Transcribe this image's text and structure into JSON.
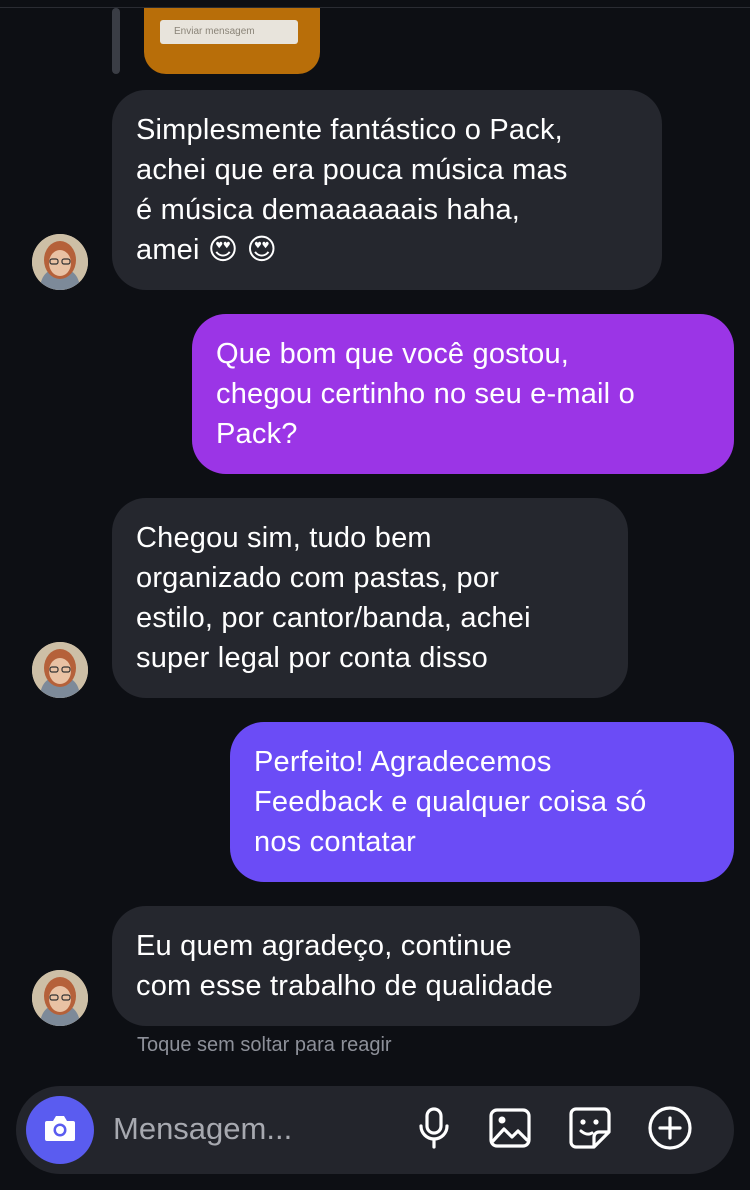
{
  "reply_preview": {
    "text": "Enviar mensagem"
  },
  "messages": [
    {
      "direction": "incoming",
      "text": "Simplesmente fantástico o Pack,\nachei que era pouca música mas\né música demaaaaaais haha,\namei 😍 😍"
    },
    {
      "direction": "outgoing",
      "text": "Que bom que você gostou,\nchegou certinho no seu e-mail o\nPack?"
    },
    {
      "direction": "incoming",
      "text": "Chegou sim, tudo bem\norganizado com pastas, por\nestilo, por cantor/banda, achei\nsuper legal por conta disso"
    },
    {
      "direction": "outgoing",
      "text": "Perfeito! Agradecemos\nFeedback e qualquer coisa só\nnos contatar"
    },
    {
      "direction": "incoming",
      "text": "Eu quem agradeço, continue\ncom esse trabalho de qualidade"
    }
  ],
  "hint": "Toque sem soltar para reagir",
  "composer": {
    "placeholder": "Mensagem...",
    "icons": [
      "camera-icon",
      "microphone-icon",
      "image-icon",
      "sticker-icon",
      "plus-icon"
    ]
  },
  "colors": {
    "background": "#0d0f14",
    "incoming_bubble": "#25272e",
    "outgoing_bubble_1": "#9b35e6",
    "outgoing_bubble_2": "#6b4cf6",
    "camera_button": "#5a5cf0",
    "reply_card": "#b86e09"
  }
}
